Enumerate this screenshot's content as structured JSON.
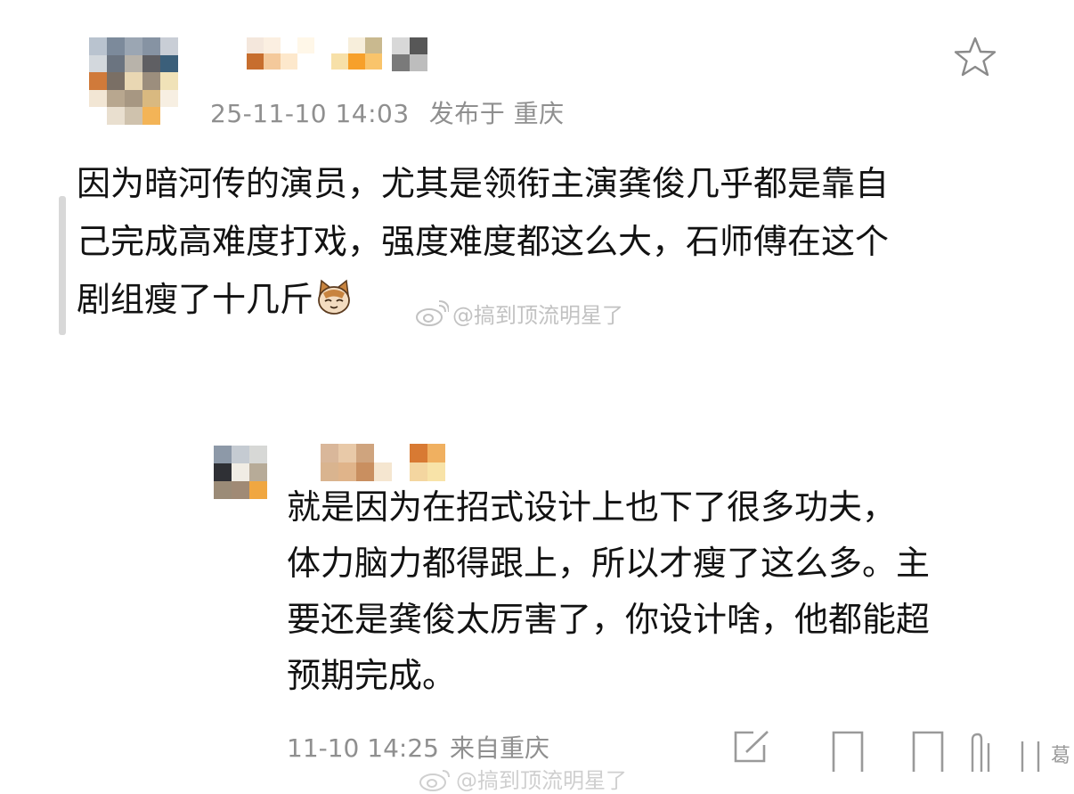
{
  "main_comment": {
    "timestamp": "25-11-10 14:03",
    "location_label": "发布于 重庆",
    "lines": [
      "因为暗河传的演员，尤其是领衔主演龚俊几乎都是靠自",
      "己完成高难度打戏，强度难度都这么大，石师傅在这个",
      "剧组瘦了十几斤"
    ],
    "emoji": "cat-face-icon"
  },
  "watermark": {
    "text": "@搞到顶流明星了",
    "bottom_text": "@搞到顶流明星了",
    "icon": "weibo-icon"
  },
  "reply": {
    "lines": [
      "就是因为在招式设计上也下了很多功夫，",
      "体力脑力都得跟上，所以才瘦了这么多。主",
      "要还是龚俊太厉害了，你设计啥，他都能超",
      "预期完成。"
    ],
    "timestamp": "11-10 14:25",
    "location_label": "来自重庆",
    "edge_text": "葛"
  },
  "icons": {
    "star": "star-outline-icon",
    "edit": "edit-icon"
  },
  "colors": {
    "text": "#121212",
    "meta": "#8f8f8f",
    "watermark": "#c2c2c2",
    "quote_bar": "#d8d8d8"
  },
  "mosaic": {
    "avatar_main": [
      "#b9c3cf",
      "#7c8a9b",
      "#9ba6b3",
      "#8693a3",
      "#c9ced6",
      "#d3d8dd",
      "#6b7480",
      "#b8b3aa",
      "#5f5f63",
      "#3b5f7a",
      "#d07a3a",
      "#7a6f65",
      "#e9d7b3",
      "#9c8e7d",
      "#f0e2b8",
      "#f2e6d4",
      "#b8a78f",
      "#a79782",
      "#d9b980",
      "#f7efe2",
      "#ffffff",
      "#e9dfcf",
      "#cfc2ad",
      "#f3b457",
      "#ffffff"
    ],
    "name_main_a": [
      "#ffffff",
      "#f4e7dc",
      "#fbefe1",
      "#ffffff",
      "#fff7e8",
      "#ffffff",
      "#ffffff",
      "#f7eedb",
      "#c9b98f",
      "#ffffff",
      "#c76e2e",
      "#f4c99b",
      "#fde8cc",
      "#ffffff",
      "#ffffff",
      "#f7e0a8",
      "#f7a02a",
      "#f9c46b"
    ],
    "name_main_b": [
      "#d8d8d8",
      "#575757",
      "#7a7a7a",
      "#bdbdbd"
    ],
    "avatar_reply": [
      "#8d99a8",
      "#c5cbd2",
      "#d7d8d6",
      "#2f3035",
      "#f0ece4",
      "#b7ab98",
      "#9b8b77",
      "#a08a75",
      "#f0a741"
    ],
    "name_reply": [
      "#ffffff",
      "#d9b79a",
      "#e8c9a8",
      "#cfa47e",
      "#ffffff",
      "#ffffff",
      "#d87a33",
      "#f0b060",
      "#ffffff",
      "#ffffff",
      "#d9b48f",
      "#e0b48a",
      "#c98f60",
      "#f5e6d0",
      "#ffffff",
      "#f4d6a0",
      "#f8e3a8",
      "#ffffff"
    ]
  }
}
